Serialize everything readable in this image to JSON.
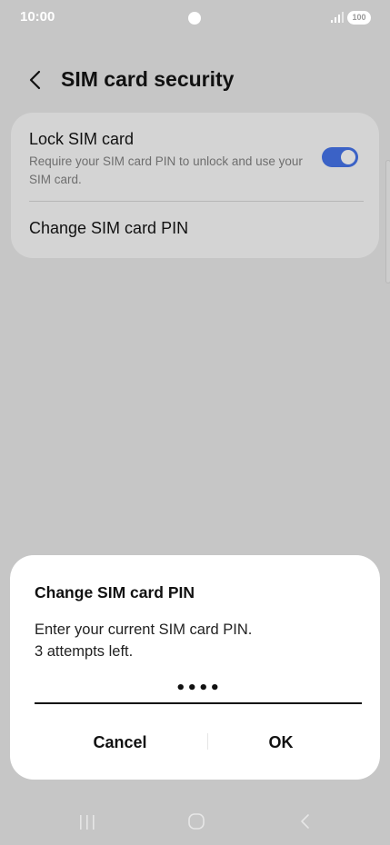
{
  "status_bar": {
    "time": "10:00",
    "battery": "100"
  },
  "header": {
    "title": "SIM card security"
  },
  "settings": {
    "lock_sim": {
      "title": "Lock SIM card",
      "description": "Require your SIM card PIN to unlock and use your SIM card.",
      "enabled": true
    },
    "change_pin": {
      "label": "Change SIM card PIN"
    }
  },
  "dialog": {
    "title": "Change SIM card PIN",
    "message_line1": "Enter your current SIM card PIN.",
    "message_line2": "3 attempts left.",
    "pin_value": "••••",
    "cancel_label": "Cancel",
    "ok_label": "OK"
  },
  "colors": {
    "accent": "#3b62c6",
    "scrim": "#c6c6c6",
    "dialog_bg": "#ffffff"
  },
  "icons": {
    "back": "chevron-left-icon",
    "signal": "signal-icon",
    "nav_recents": "recents-icon",
    "nav_home": "home-icon",
    "nav_back": "back-icon"
  }
}
